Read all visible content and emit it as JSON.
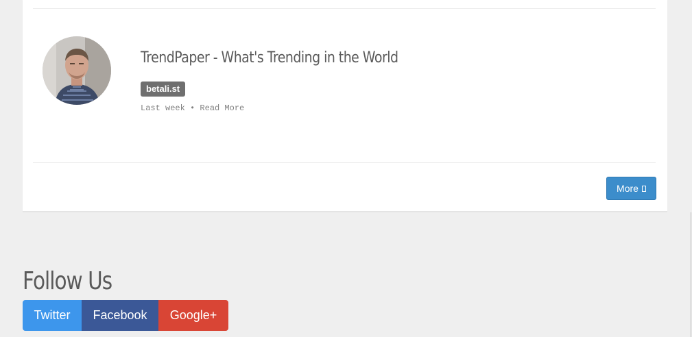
{
  "story": {
    "title": "TrendPaper - What's Trending in the World",
    "source": "betali.st",
    "time": "Last week",
    "separator": "•",
    "read_more": "Read More"
  },
  "card_footer": {
    "more_label": "More",
    "more_icon": "missing-glyph-box-icon"
  },
  "follow": {
    "heading": "Follow Us",
    "buttons": [
      {
        "label": "Twitter",
        "color": "#3d96ec"
      },
      {
        "label": "Facebook",
        "color": "#3b5897"
      },
      {
        "label": "Google+",
        "color": "#d94535"
      }
    ]
  },
  "colors": {
    "page_background": "#efefef",
    "card_background": "#ffffff",
    "accent_button": "#3c8dcb",
    "badge": "#6f6f6f",
    "heading_text": "#5a5a5a"
  }
}
